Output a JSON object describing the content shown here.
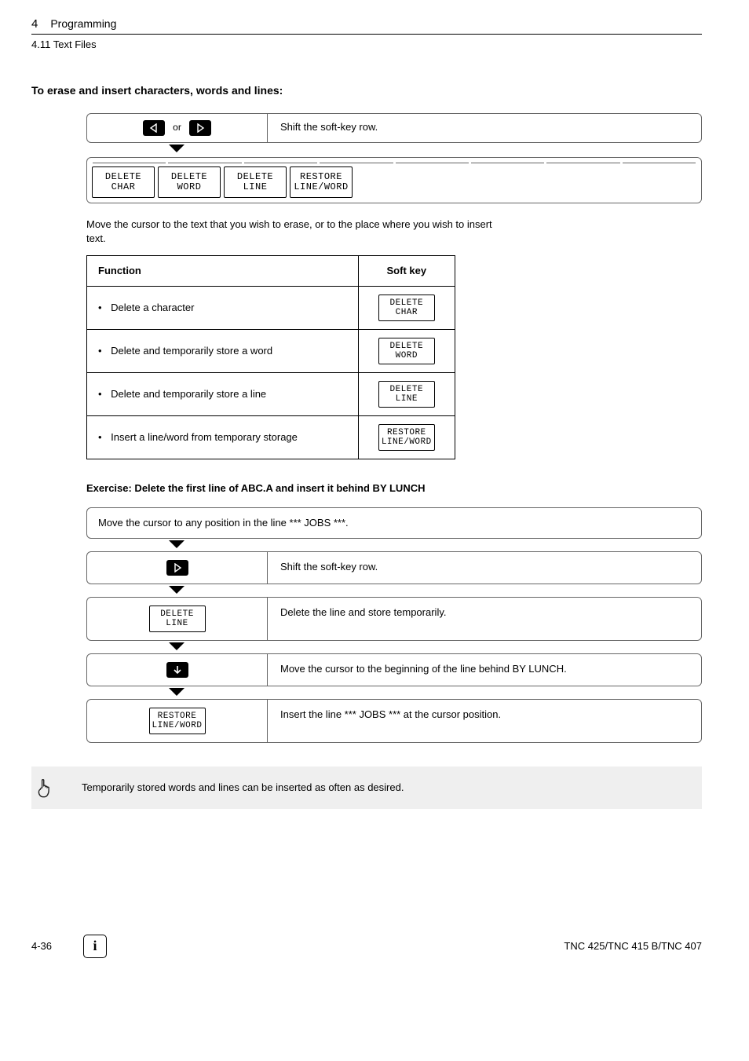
{
  "header": {
    "chapter_number": "4",
    "chapter_title": "Programming",
    "section_number": "4.11",
    "section_title": "Text Files"
  },
  "section_heading": "To erase and insert characters, words and lines:",
  "shift_row": {
    "or": "or",
    "instruction": "Shift the soft-key row."
  },
  "softkeys": [
    {
      "l1": "DELETE",
      "l2": "CHAR"
    },
    {
      "l1": "DELETE",
      "l2": "WORD"
    },
    {
      "l1": "DELETE",
      "l2": "LINE"
    },
    {
      "l1": "RESTORE",
      "l2": "LINE/WORD"
    }
  ],
  "intro_para": "Move the cursor to the text that you wish to erase, or to the place where you wish to insert text.",
  "ftable": {
    "head_function": "Function",
    "head_softkey": "Soft key",
    "rows": [
      {
        "fn": "Delete a character",
        "sk1": "DELETE",
        "sk2": "CHAR"
      },
      {
        "fn": "Delete and temporarily store a word",
        "sk1": "DELETE",
        "sk2": "WORD"
      },
      {
        "fn": "Delete and temporarily store a line",
        "sk1": "DELETE",
        "sk2": "LINE"
      },
      {
        "fn": "Insert a line/word from temporary storage",
        "sk1": "RESTORE",
        "sk2": "LINE/WORD"
      }
    ]
  },
  "exercise_title": "Exercise: Delete the first line of ABC.A and insert it behind BY LUNCH",
  "flow": {
    "step1": "Move the cursor to any position in the line *** JOBS ***.",
    "step2_instr": "Shift the soft-key row.",
    "step3_sk1": "DELETE",
    "step3_sk2": "LINE",
    "step3_instr": "Delete the line and store temporarily.",
    "step4_instr": "Move the cursor to the beginning of the line behind BY LUNCH.",
    "step5_sk1": "RESTORE",
    "step5_sk2": "LINE/WORD",
    "step5_instr": "Insert the line *** JOBS *** at the cursor position."
  },
  "note": "Temporarily stored words and lines can be inserted as often as desired.",
  "footer": {
    "page": "4-36",
    "model": "TNC 425/TNC 415 B/TNC 407",
    "info_symbol": "i"
  },
  "icons": {
    "tri_left": "◁",
    "tri_right": "▷",
    "arrow_down": "↓"
  }
}
